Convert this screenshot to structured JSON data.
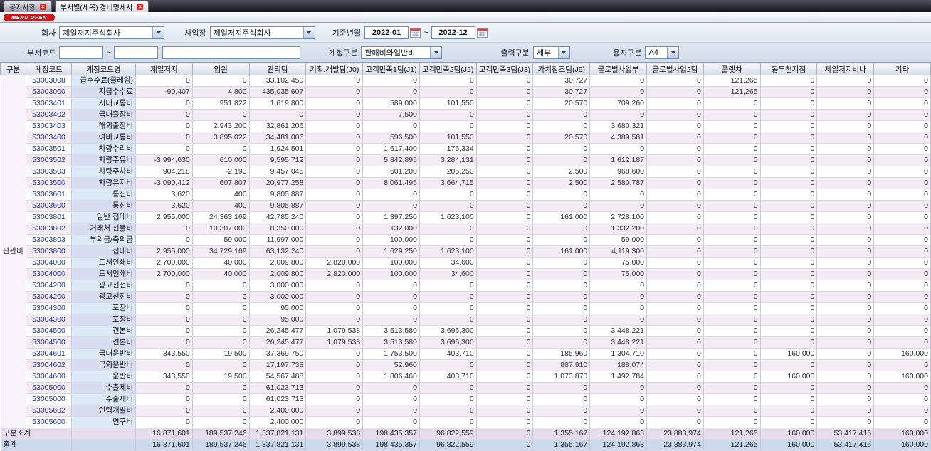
{
  "tabs": [
    {
      "label": "공지사항"
    },
    {
      "label": "부서별(세목) 경비명세서"
    }
  ],
  "menu_open_label": "MENU OPEN",
  "filters": {
    "company_label": "회사",
    "company_value": "제일저지주식회사",
    "site_label": "사업장",
    "site_value": "제일저지주식회사",
    "period_label": "기준년월",
    "period_from": "2022-01",
    "period_to": "2022-12",
    "tilde": "~",
    "dept_code_label": "부서코드",
    "dept_from": "",
    "dept_to": "",
    "dept_name": "",
    "account_type_label": "계정구분",
    "account_type_value": "판매비와일반비",
    "output_label": "출력구분",
    "output_value": "세부",
    "paper_label": "용지구분",
    "paper_value": "A4"
  },
  "table": {
    "headers": [
      "구분",
      "계정코드",
      "계정코드명",
      "제일저지",
      "임원",
      "관리팀",
      "기획.개발팀(J0)",
      "고객만족1팀(J1)",
      "고객만족2팀(J2)",
      "고객만족3팀(J3)",
      "가치창조팀(J9)",
      "글로벌사업부",
      "글로벌사업2팀",
      "플렛차",
      "동두천지점",
      "제일저지비나",
      "기타"
    ],
    "group_label": "판관비",
    "rows": [
      {
        "code": "53003008",
        "name": "급수수료(클레임)",
        "values": [
          "0",
          "0",
          "33,102,450",
          "0",
          "0",
          "0",
          "0",
          "30,727",
          "0",
          "0",
          "121,265",
          "0",
          "0",
          "0"
        ]
      },
      {
        "code": "53003000",
        "name": "지급수수료",
        "values": [
          "-90,407",
          "4,800",
          "435,035,607",
          "0",
          "0",
          "0",
          "0",
          "30,727",
          "0",
          "0",
          "121,265",
          "0",
          "0",
          "0"
        ]
      },
      {
        "code": "53003401",
        "name": "시내교통비",
        "values": [
          "0",
          "951,822",
          "1,619,800",
          "0",
          "589,000",
          "101,550",
          "0",
          "20,570",
          "709,260",
          "0",
          "0",
          "0",
          "0",
          "0"
        ]
      },
      {
        "code": "53003402",
        "name": "국내출장비",
        "values": [
          "0",
          "0",
          "0",
          "0",
          "7,500",
          "0",
          "0",
          "0",
          "0",
          "0",
          "0",
          "0",
          "0",
          "0"
        ]
      },
      {
        "code": "53003403",
        "name": "해외출장비",
        "values": [
          "0",
          "2,943,200",
          "32,861,206",
          "0",
          "0",
          "0",
          "0",
          "0",
          "3,680,321",
          "0",
          "0",
          "0",
          "0",
          "0"
        ]
      },
      {
        "code": "53003400",
        "name": "여비교통비",
        "values": [
          "0",
          "3,895,022",
          "34,481,006",
          "0",
          "596,500",
          "101,550",
          "0",
          "20,570",
          "4,389,581",
          "0",
          "0",
          "0",
          "0",
          "0"
        ]
      },
      {
        "code": "53003501",
        "name": "차량수리비",
        "values": [
          "0",
          "0",
          "1,924,501",
          "0",
          "1,617,400",
          "175,334",
          "0",
          "0",
          "0",
          "0",
          "0",
          "0",
          "0",
          "0"
        ]
      },
      {
        "code": "53003502",
        "name": "차량주유비",
        "values": [
          "-3,994,630",
          "610,000",
          "9,595,712",
          "0",
          "5,842,895",
          "3,284,131",
          "0",
          "0",
          "1,612,187",
          "0",
          "0",
          "0",
          "0",
          "0"
        ]
      },
      {
        "code": "53003503",
        "name": "차량주차비",
        "values": [
          "904,218",
          "-2,193",
          "9,457,045",
          "0",
          "601,200",
          "205,250",
          "0",
          "2,500",
          "968,600",
          "0",
          "0",
          "0",
          "0",
          "0"
        ]
      },
      {
        "code": "53003500",
        "name": "차량유지비",
        "values": [
          "-3,090,412",
          "607,807",
          "20,977,258",
          "0",
          "8,061,495",
          "3,664,715",
          "0",
          "2,500",
          "2,580,787",
          "0",
          "0",
          "0",
          "0",
          "0"
        ]
      },
      {
        "code": "53003601",
        "name": "통신비",
        "values": [
          "3,620",
          "400",
          "9,805,887",
          "0",
          "0",
          "0",
          "0",
          "0",
          "0",
          "0",
          "0",
          "0",
          "0",
          "0"
        ]
      },
      {
        "code": "53003600",
        "name": "통신비",
        "values": [
          "3,620",
          "400",
          "9,805,887",
          "0",
          "0",
          "0",
          "0",
          "0",
          "0",
          "0",
          "0",
          "0",
          "0",
          "0"
        ]
      },
      {
        "code": "53003801",
        "name": "일반 접대비",
        "values": [
          "2,955,000",
          "24,363,169",
          "42,785,240",
          "0",
          "1,397,250",
          "1,623,100",
          "0",
          "161,000",
          "2,728,100",
          "0",
          "0",
          "0",
          "0",
          "0"
        ]
      },
      {
        "code": "53003802",
        "name": "거래처 선물비",
        "values": [
          "0",
          "10,307,000",
          "8,350,000",
          "0",
          "132,000",
          "0",
          "0",
          "0",
          "1,332,200",
          "0",
          "0",
          "0",
          "0",
          "0"
        ]
      },
      {
        "code": "53003803",
        "name": "부의금/축의금",
        "values": [
          "0",
          "59,000",
          "11,997,000",
          "0",
          "100,000",
          "0",
          "0",
          "0",
          "59,000",
          "0",
          "0",
          "0",
          "0",
          "0"
        ]
      },
      {
        "code": "53003800",
        "name": "접대비",
        "values": [
          "2,955,000",
          "34,729,169",
          "63,132,240",
          "0",
          "1,629,250",
          "1,623,100",
          "0",
          "161,000",
          "4,119,300",
          "0",
          "0",
          "0",
          "0",
          "0"
        ]
      },
      {
        "code": "53004000",
        "name": "도서인쇄비",
        "values": [
          "2,700,000",
          "40,000",
          "2,009,800",
          "2,820,000",
          "100,000",
          "34,600",
          "0",
          "0",
          "75,000",
          "0",
          "0",
          "0",
          "0",
          "0"
        ]
      },
      {
        "code": "53004000",
        "name": "도서인쇄비",
        "values": [
          "2,700,000",
          "40,000",
          "2,009,800",
          "2,820,000",
          "100,000",
          "34,600",
          "0",
          "0",
          "75,000",
          "0",
          "0",
          "0",
          "0",
          "0"
        ]
      },
      {
        "code": "53004200",
        "name": "광고선전비",
        "values": [
          "0",
          "0",
          "3,000,000",
          "0",
          "0",
          "0",
          "0",
          "0",
          "0",
          "0",
          "0",
          "0",
          "0",
          "0"
        ]
      },
      {
        "code": "53004200",
        "name": "광고선전비",
        "values": [
          "0",
          "0",
          "3,000,000",
          "0",
          "0",
          "0",
          "0",
          "0",
          "0",
          "0",
          "0",
          "0",
          "0",
          "0"
        ]
      },
      {
        "code": "53004300",
        "name": "포장비",
        "values": [
          "0",
          "0",
          "95,000",
          "0",
          "0",
          "0",
          "0",
          "0",
          "0",
          "0",
          "0",
          "0",
          "0",
          "0"
        ]
      },
      {
        "code": "53004300",
        "name": "포장비",
        "values": [
          "0",
          "0",
          "95,000",
          "0",
          "0",
          "0",
          "0",
          "0",
          "0",
          "0",
          "0",
          "0",
          "0",
          "0"
        ]
      },
      {
        "code": "53004500",
        "name": "견본비",
        "values": [
          "0",
          "0",
          "26,245,477",
          "1,079,538",
          "3,513,580",
          "3,696,300",
          "0",
          "0",
          "3,448,221",
          "0",
          "0",
          "0",
          "0",
          "0"
        ]
      },
      {
        "code": "53004500",
        "name": "견본비",
        "values": [
          "0",
          "0",
          "26,245,477",
          "1,079,538",
          "3,513,580",
          "3,696,300",
          "0",
          "0",
          "3,448,221",
          "0",
          "0",
          "0",
          "0",
          "0"
        ]
      },
      {
        "code": "53004601",
        "name": "국내운반비",
        "values": [
          "343,550",
          "19,500",
          "37,369,750",
          "0",
          "1,753,500",
          "403,710",
          "0",
          "185,960",
          "1,304,710",
          "0",
          "0",
          "160,000",
          "0",
          "160,000"
        ]
      },
      {
        "code": "53004602",
        "name": "국외운반비",
        "values": [
          "0",
          "0",
          "17,197,738",
          "0",
          "52,960",
          "0",
          "0",
          "887,910",
          "188,074",
          "0",
          "0",
          "0",
          "0",
          "0"
        ]
      },
      {
        "code": "53004600",
        "name": "운반비",
        "values": [
          "343,550",
          "19,500",
          "54,567,488",
          "0",
          "1,806,460",
          "403,710",
          "0",
          "1,073,870",
          "1,492,784",
          "0",
          "0",
          "160,000",
          "0",
          "160,000"
        ]
      },
      {
        "code": "53005000",
        "name": "수출제비",
        "values": [
          "0",
          "0",
          "61,023,713",
          "0",
          "0",
          "0",
          "0",
          "0",
          "0",
          "0",
          "0",
          "0",
          "0",
          "0"
        ]
      },
      {
        "code": "53005000",
        "name": "수출제비",
        "values": [
          "0",
          "0",
          "61,023,713",
          "0",
          "0",
          "0",
          "0",
          "0",
          "0",
          "0",
          "0",
          "0",
          "0",
          "0"
        ]
      },
      {
        "code": "53005602",
        "name": "인력개발비",
        "values": [
          "0",
          "0",
          "2,400,000",
          "0",
          "0",
          "0",
          "0",
          "0",
          "0",
          "0",
          "0",
          "0",
          "0",
          "0"
        ]
      },
      {
        "code": "53005600",
        "name": "연구비",
        "values": [
          "0",
          "0",
          "2,400,000",
          "0",
          "0",
          "0",
          "0",
          "0",
          "0",
          "0",
          "0",
          "0",
          "0",
          "0"
        ]
      }
    ],
    "subtotal": {
      "label": "구분소계",
      "values": [
        "16,871,601",
        "189,537,246",
        "1,337,821,131",
        "3,899,538",
        "198,435,357",
        "96,822,559",
        "0",
        "1,355,167",
        "124,192,863",
        "23,883,974",
        "121,265",
        "160,000",
        "53,417,416",
        "160,000"
      ]
    },
    "total": {
      "label": "총계",
      "values": [
        "16,871,601",
        "189,537,246",
        "1,337,821,131",
        "3,899,538",
        "198,435,357",
        "96,822,559",
        "0",
        "1,355,167",
        "124,192,863",
        "23,883,974",
        "121,265",
        "160,000",
        "53,417,416",
        "160,000"
      ]
    }
  }
}
